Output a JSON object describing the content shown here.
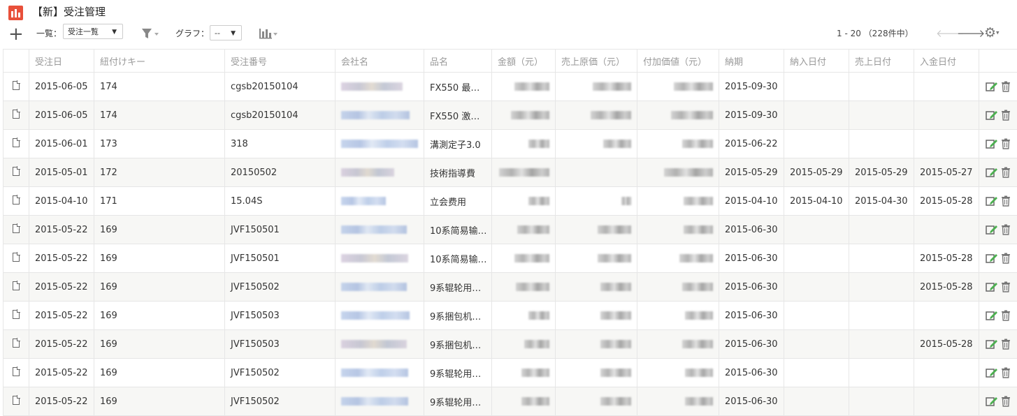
{
  "header": {
    "title": "【新】受注管理",
    "list_label": "一覧：",
    "list_select": "受注一覧",
    "graph_label": "グラフ：",
    "graph_select": "--",
    "pager_text": "1 - 20 （228件中）"
  },
  "table": {
    "columns": [
      "受注日",
      "紐付けキー",
      "受注番号",
      "会社名",
      "品名",
      "金額（元）",
      "売上原価（元）",
      "付加価値（元）",
      "納期",
      "納入日付",
      "売上日付",
      "入金日付"
    ],
    "rows": [
      {
        "date": "2015-06-05",
        "key": "174",
        "order_no": "cgsb20150104",
        "product": "FX550 最…",
        "deadline": "2015-09-30",
        "delivery": "",
        "sales": "",
        "payment": ""
      },
      {
        "date": "2015-06-05",
        "key": "174",
        "order_no": "cgsb20150104",
        "product": "FX550 激…",
        "deadline": "2015-09-30",
        "delivery": "",
        "sales": "",
        "payment": ""
      },
      {
        "date": "2015-06-01",
        "key": "173",
        "order_no": "318",
        "product": "溝測定子3.0",
        "deadline": "2015-06-22",
        "delivery": "",
        "sales": "",
        "payment": ""
      },
      {
        "date": "2015-05-01",
        "key": "172",
        "order_no": "20150502",
        "product": "技術指導費",
        "deadline": "2015-05-29",
        "delivery": "2015-05-29",
        "sales": "2015-05-29",
        "payment": "2015-05-27"
      },
      {
        "date": "2015-04-10",
        "key": "171",
        "order_no": "15.04S",
        "product": "立会费用",
        "deadline": "2015-04-10",
        "delivery": "2015-04-10",
        "sales": "2015-04-30",
        "payment": "2015-05-28"
      },
      {
        "date": "2015-05-22",
        "key": "169",
        "order_no": "JVF150501",
        "product": "10系简易输…",
        "deadline": "2015-06-30",
        "delivery": "",
        "sales": "",
        "payment": ""
      },
      {
        "date": "2015-05-22",
        "key": "169",
        "order_no": "JVF150501",
        "product": "10系简易输…",
        "deadline": "2015-06-30",
        "delivery": "",
        "sales": "",
        "payment": "2015-05-28"
      },
      {
        "date": "2015-05-22",
        "key": "169",
        "order_no": "JVF150502",
        "product": "9系辊轮用…",
        "deadline": "2015-06-30",
        "delivery": "",
        "sales": "",
        "payment": "2015-05-28"
      },
      {
        "date": "2015-05-22",
        "key": "169",
        "order_no": "JVF150503",
        "product": "9系捆包机…",
        "deadline": "2015-06-30",
        "delivery": "",
        "sales": "",
        "payment": ""
      },
      {
        "date": "2015-05-22",
        "key": "169",
        "order_no": "JVF150503",
        "product": "9系捆包机…",
        "deadline": "2015-06-30",
        "delivery": "",
        "sales": "",
        "payment": "2015-05-28"
      },
      {
        "date": "2015-05-22",
        "key": "169",
        "order_no": "JVF150502",
        "product": "9系辊轮用…",
        "deadline": "2015-06-30",
        "delivery": "",
        "sales": "",
        "payment": ""
      },
      {
        "date": "2015-05-22",
        "key": "169",
        "order_no": "JVF150502",
        "product": "9系辊轮用…",
        "deadline": "2015-06-30",
        "delivery": "",
        "sales": "",
        "payment": ""
      }
    ]
  },
  "colors": {
    "accent": "#e8503a"
  }
}
